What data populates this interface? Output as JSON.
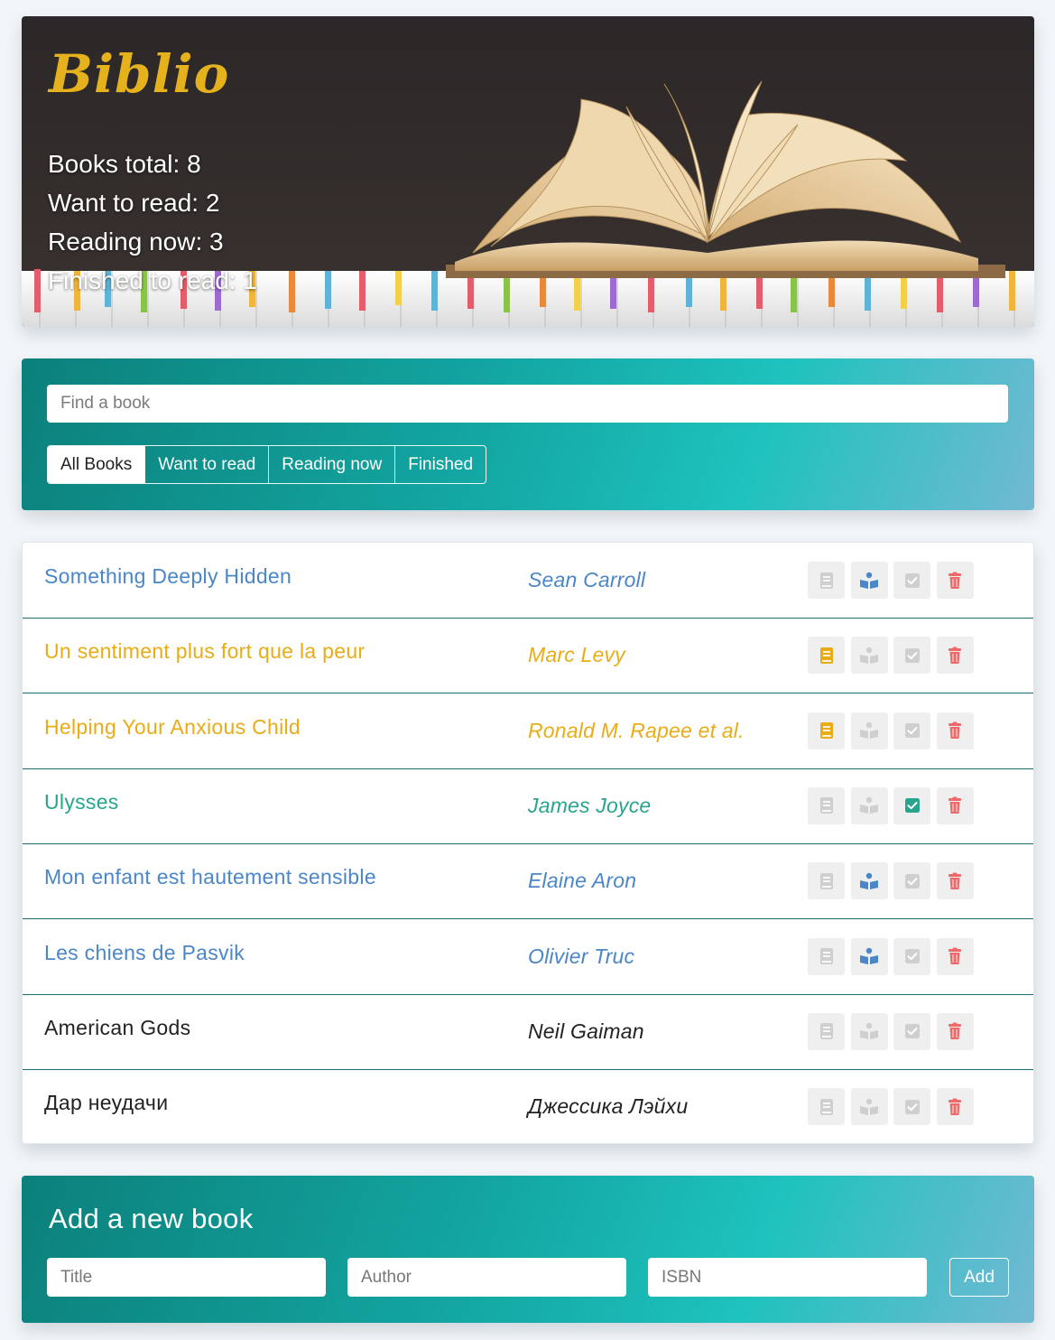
{
  "app": {
    "brand": "Biblio"
  },
  "stats": {
    "total": "Books total: 8",
    "want": "Want to read: 2",
    "reading": "Reading now: 3",
    "finished": "Finished to read: 1"
  },
  "search": {
    "placeholder": "Find a book"
  },
  "filters": [
    {
      "label": "All Books",
      "active": true
    },
    {
      "label": "Want to read",
      "active": false
    },
    {
      "label": "Reading now",
      "active": false
    },
    {
      "label": "Finished",
      "active": false
    }
  ],
  "books": [
    {
      "title": "Something Deeply Hidden",
      "author": "Sean Carroll",
      "status": "reading"
    },
    {
      "title": "Un sentiment plus fort que la peur",
      "author": "Marc Levy",
      "status": "want"
    },
    {
      "title": "Helping Your Anxious Child",
      "author": "Ronald M. Rapee et al.",
      "status": "want"
    },
    {
      "title": "Ulysses",
      "author": "James Joyce",
      "status": "finished"
    },
    {
      "title": "Mon enfant est hautement sensible",
      "author": "Elaine Aron",
      "status": "reading"
    },
    {
      "title": "Les chiens de Pasvik",
      "author": "Olivier Truc",
      "status": "reading"
    },
    {
      "title": "American Gods",
      "author": "Neil Gaiman",
      "status": "none"
    },
    {
      "title": "Дар неудачи",
      "author": "Джессика Лэйхи",
      "status": "none"
    }
  ],
  "colors": {
    "want": "#e9ac16",
    "reading": "#4a86c8",
    "finished": "#27a58d",
    "delete": "#ee6a6a",
    "inactive": "#cfcfcf",
    "brand": "#e5b21e"
  },
  "icons": [
    "book-icon",
    "reader-icon",
    "check-icon",
    "trash-icon"
  ],
  "add": {
    "heading": "Add a new book",
    "title_placeholder": "Title",
    "author_placeholder": "Author",
    "isbn_placeholder": "ISBN",
    "button": "Add"
  }
}
